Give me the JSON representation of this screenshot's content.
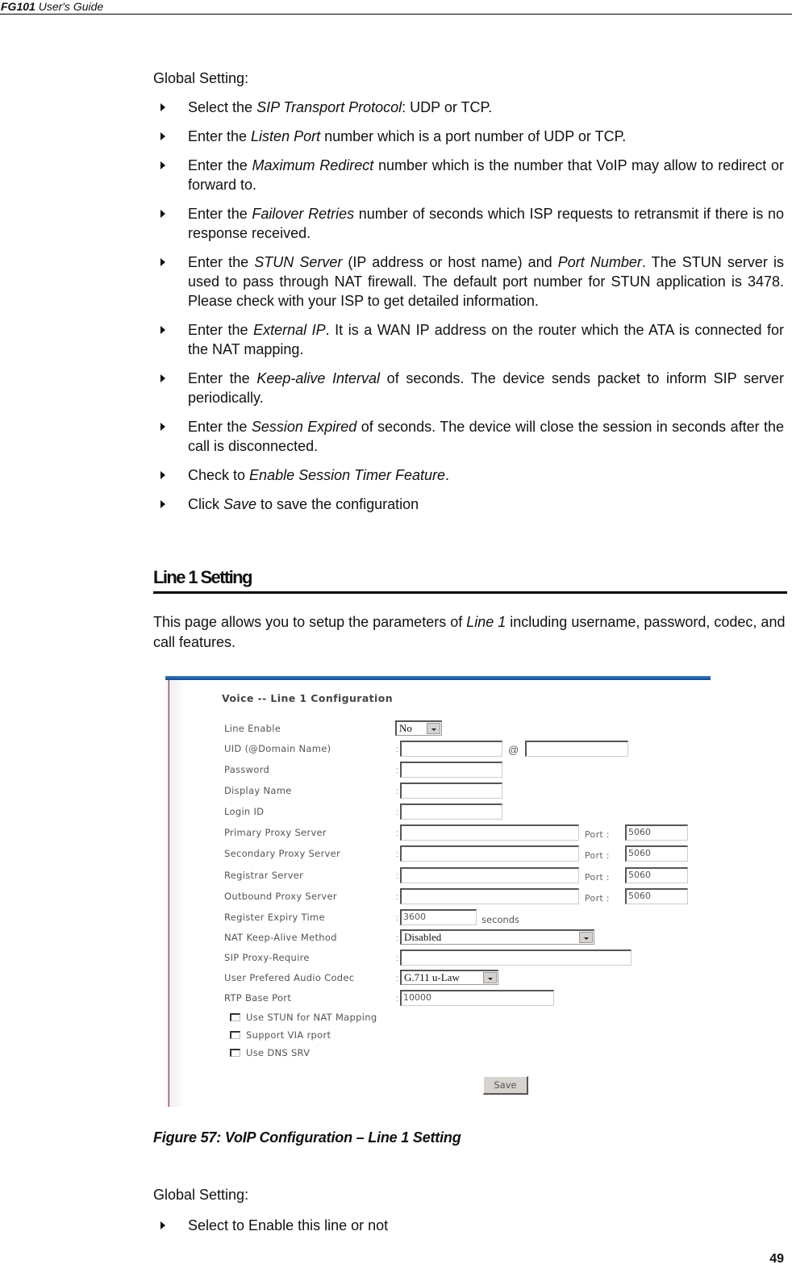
{
  "header": {
    "product": "FG101",
    "guide": "User's Guide"
  },
  "section1": {
    "label": "Global Setting:",
    "bullets": [
      {
        "pre": "Select the ",
        "em": "SIP Transport Protocol",
        "post": ": UDP or TCP."
      },
      {
        "pre": "Enter the ",
        "em": "Listen Port",
        "post": " number which is a port number of UDP or TCP."
      },
      {
        "pre": "Enter the ",
        "em": "Maximum Redirect",
        "post": " number which is the number that VoIP may allow to redirect or forward to."
      },
      {
        "pre": "Enter the ",
        "em": "Failover Retries",
        "post": " number of seconds which ISP requests to retransmit if there is no response received."
      },
      {
        "pre": "Enter the ",
        "em": "STUN Server",
        "mid": " (IP address or host name) and ",
        "em2": "Port Number",
        "post": ". The STUN server is used to pass through NAT firewall. The default port number for STUN application is 3478. Please check with your ISP to get detailed information."
      },
      {
        "pre": "Enter the ",
        "em": "External IP",
        "post": ". It is a WAN IP address on the router which the ATA is connected for the NAT mapping."
      },
      {
        "pre": "Enter the ",
        "em": "Keep-alive Interval",
        "post": " of seconds. The device sends packet to inform SIP server periodically."
      },
      {
        "pre": "Enter the ",
        "em": "Session Expired",
        "post": " of seconds. The device will close the session in seconds after the call is disconnected."
      },
      {
        "pre": "Check to ",
        "em": "Enable Session Timer Feature",
        "post": "."
      },
      {
        "pre": "Click ",
        "em": "Save",
        "post": " to save the configuration"
      }
    ]
  },
  "heading": "Line 1 Setting",
  "intro": {
    "pre": "This page allows you to setup the parameters of ",
    "em": "Line 1",
    "post": " including username, password, codec, and call features."
  },
  "screenshot": {
    "title": "Voice -- Line 1 Configuration",
    "fields": {
      "line_enable": {
        "label": "Line Enable",
        "value": "No"
      },
      "uid": {
        "label": "UID (@Domain Name)",
        "value": "",
        "at": "@",
        "domain": ""
      },
      "password": {
        "label": "Password",
        "value": ""
      },
      "display_name": {
        "label": "Display Name",
        "value": ""
      },
      "login_id": {
        "label": "Login ID",
        "value": ""
      },
      "primary_proxy": {
        "label": "Primary Proxy Server",
        "value": "",
        "port": "5060"
      },
      "secondary_proxy": {
        "label": "Secondary Proxy Server",
        "value": "",
        "port": "5060"
      },
      "registrar": {
        "label": "Registrar Server",
        "value": "",
        "port": "5060"
      },
      "outbound_proxy": {
        "label": "Outbound Proxy Server",
        "value": "",
        "port": "5060"
      },
      "register_expiry": {
        "label": "Register Expiry Time",
        "value": "3600",
        "unit": "seconds"
      },
      "nat_keepalive": {
        "label": "NAT Keep-Alive Method",
        "value": "Disabled"
      },
      "sip_proxy_require": {
        "label": "SIP Proxy-Require",
        "value": ""
      },
      "audio_codec": {
        "label": "User Prefered Audio Codec",
        "value": "G.711 u-Law"
      },
      "rtp_base_port": {
        "label": "RTP Base Port",
        "value": "10000"
      }
    },
    "port_label": "Port :",
    "colon": ":",
    "checkboxes": [
      {
        "label": "Use STUN for NAT Mapping",
        "checked": false
      },
      {
        "label": "Support VIA rport",
        "checked": false
      },
      {
        "label": "Use DNS SRV",
        "checked": false
      }
    ],
    "save_label": "Save"
  },
  "caption": "Figure 57: VoIP Configuration – Line 1 Setting",
  "section2": {
    "label": "Global Setting:",
    "bullets": [
      {
        "text": "Select to Enable this line or not"
      }
    ]
  },
  "page_number": "49"
}
